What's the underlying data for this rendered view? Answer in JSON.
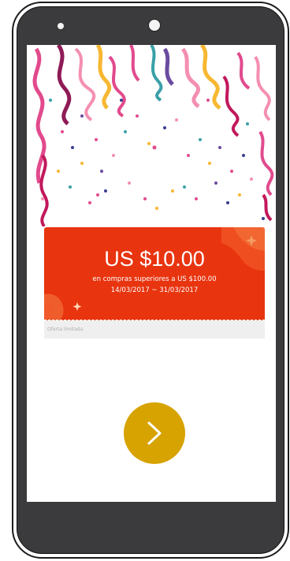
{
  "coupon": {
    "amount": "US $10.00",
    "condition": "en compras superiores a US $100.00",
    "dates": "14/03/2017 ~ 31/03/2017",
    "label": "Oferta limitada"
  },
  "next_button": {
    "icon": "chevron-right-icon"
  },
  "colors": {
    "coupon_red": "#e8340f",
    "button_gold": "#d7a300",
    "phone_body": "#3b3b3d"
  }
}
